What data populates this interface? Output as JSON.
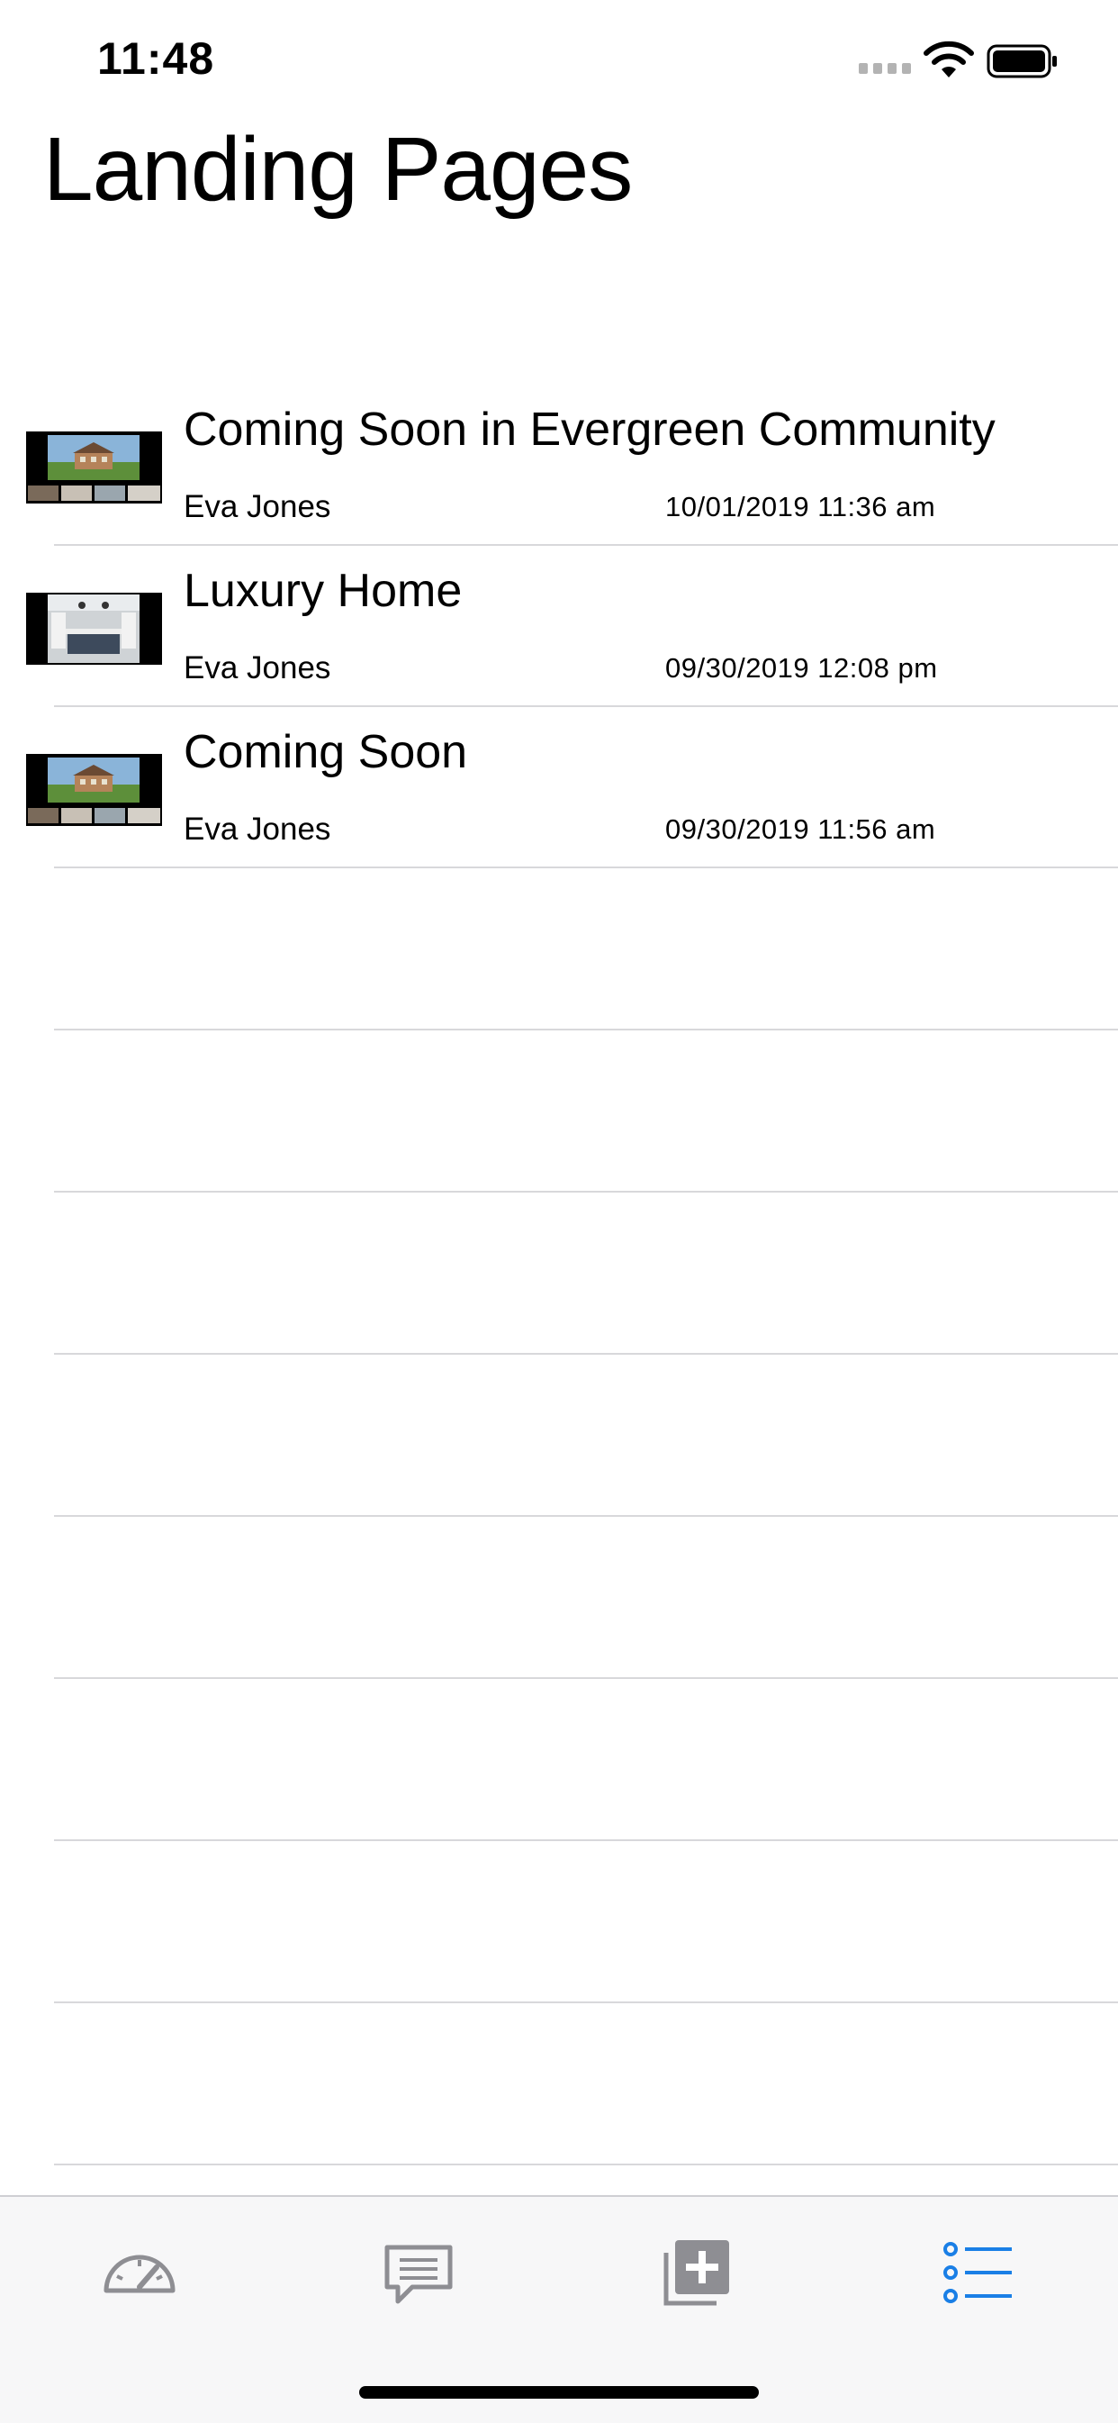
{
  "status_bar": {
    "time": "11:48",
    "icons": [
      "cellular-signal-icon",
      "wifi-icon",
      "battery-icon"
    ]
  },
  "page": {
    "title": "Landing Pages"
  },
  "landing_pages": [
    {
      "title": "Coming Soon in Evergreen Community",
      "author": "Eva Jones",
      "date": "10/01/2019 11:36 am",
      "thumbnail": "house-exterior-thumbnail"
    },
    {
      "title": "Luxury Home",
      "author": "Eva Jones",
      "date": "09/30/2019 12:08 pm",
      "thumbnail": "kitchen-interior-thumbnail"
    },
    {
      "title": "Coming Soon",
      "author": "Eva Jones",
      "date": "09/30/2019 11:56 am",
      "thumbnail": "house-exterior-thumbnail"
    }
  ],
  "tab_bar": {
    "tabs": [
      {
        "icon": "speedometer-icon",
        "selected": false
      },
      {
        "icon": "message-bubble-icon",
        "selected": false
      },
      {
        "icon": "add-page-icon",
        "selected": false
      },
      {
        "icon": "list-icon",
        "selected": true
      }
    ],
    "colors": {
      "selected": "#1a7fe6",
      "unselected": "#8e8e93"
    }
  }
}
